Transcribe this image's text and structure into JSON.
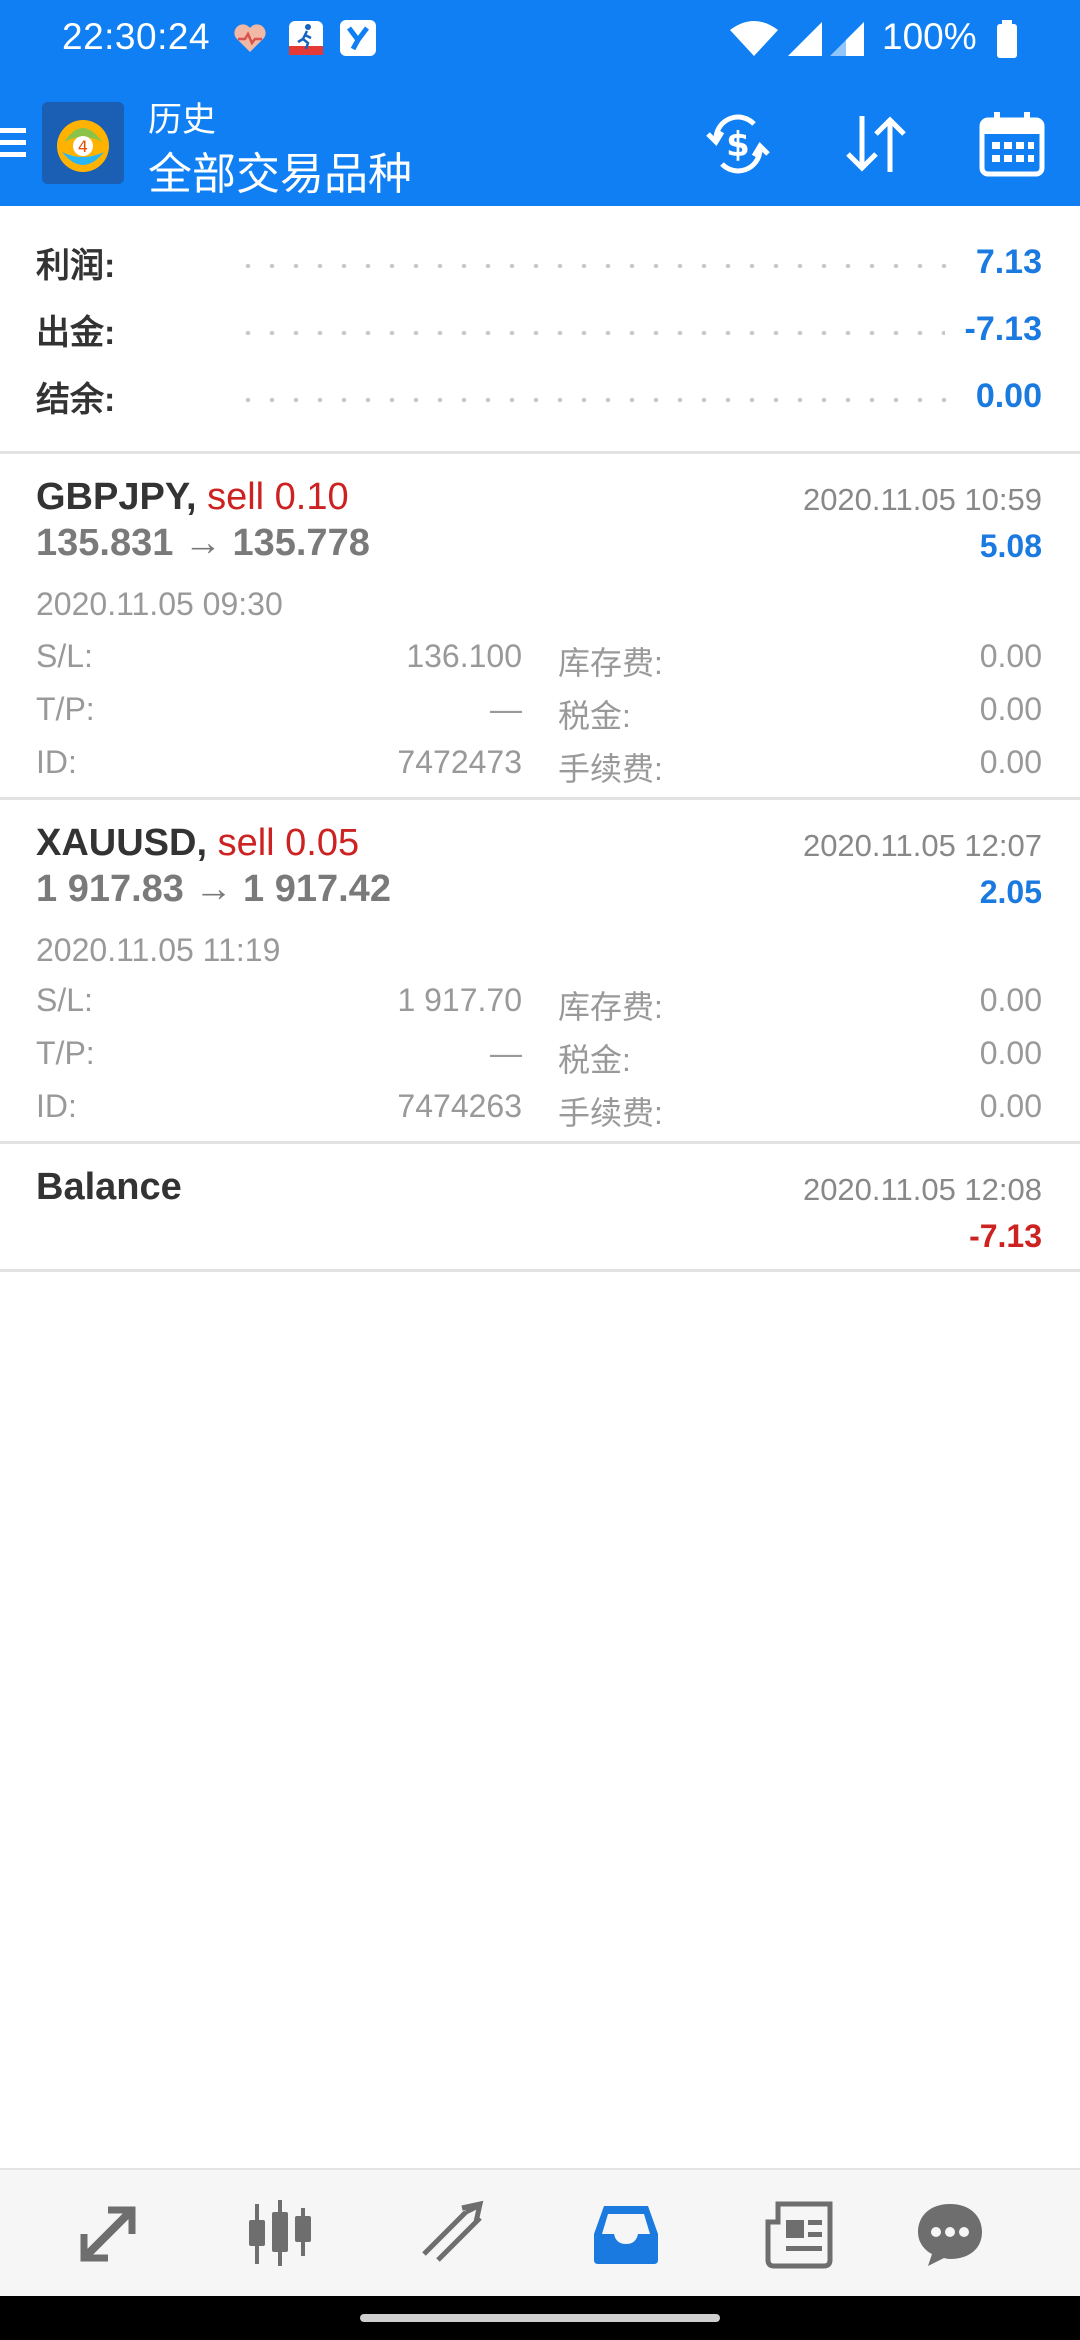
{
  "status_bar": {
    "time": "22:30:24",
    "battery": "100%",
    "icons": [
      "heart-icon",
      "walk-app-icon",
      "y-app-icon",
      "wifi-icon",
      "signal-icon",
      "signal-icon",
      "battery-icon"
    ]
  },
  "header": {
    "subtitle": "历史",
    "title": "全部交易品种",
    "actions": [
      "currency-exchange-icon",
      "sort-icon",
      "calendar-icon"
    ]
  },
  "summary": {
    "rows": [
      {
        "label": "利润:",
        "value": "7.13"
      },
      {
        "label": "出金:",
        "value": "-7.13"
      },
      {
        "label": "结余:",
        "value": "0.00"
      }
    ]
  },
  "deals": [
    {
      "symbol": "GBPJPY,",
      "type": "sell 0.10",
      "prices": "135.831 → 135.778",
      "close_time": "2020.11.05 10:59",
      "profit": "5.08",
      "open_time": "2020.11.05 09:30",
      "sl_label": "S/L:",
      "sl": "136.100",
      "tp_label": "T/P:",
      "tp": "—",
      "id_label": "ID:",
      "id": "7472473",
      "swap_label": "库存费:",
      "swap": "0.00",
      "tax_label": "税金:",
      "tax": "0.00",
      "fee_label": "手续费:",
      "fee": "0.00"
    },
    {
      "symbol": "XAUUSD,",
      "type": "sell 0.05",
      "prices": "1 917.83 → 1 917.42",
      "close_time": "2020.11.05 12:07",
      "profit": "2.05",
      "open_time": "2020.11.05 11:19",
      "sl_label": "S/L:",
      "sl": "1 917.70",
      "tp_label": "T/P:",
      "tp": "—",
      "id_label": "ID:",
      "id": "7474263",
      "swap_label": "库存费:",
      "swap": "0.00",
      "tax_label": "税金:",
      "tax": "0.00",
      "fee_label": "手续费:",
      "fee": "0.00"
    }
  ],
  "balance": {
    "label": "Balance",
    "time": "2020.11.05 12:08",
    "value": "-7.13"
  },
  "bottom_nav": [
    {
      "name": "quotes-icon",
      "active": false
    },
    {
      "name": "chart-icon",
      "active": false
    },
    {
      "name": "trade-icon",
      "active": false
    },
    {
      "name": "history-icon",
      "active": true
    },
    {
      "name": "news-icon",
      "active": false
    },
    {
      "name": "chat-icon",
      "active": false
    }
  ],
  "colors": {
    "header_bg": "#0f7ff3",
    "profit_blue": "#1a7ae0",
    "loss_red": "#cc2222",
    "nav_active": "#1a7ae0",
    "nav_inactive": "#6e6e6e"
  }
}
